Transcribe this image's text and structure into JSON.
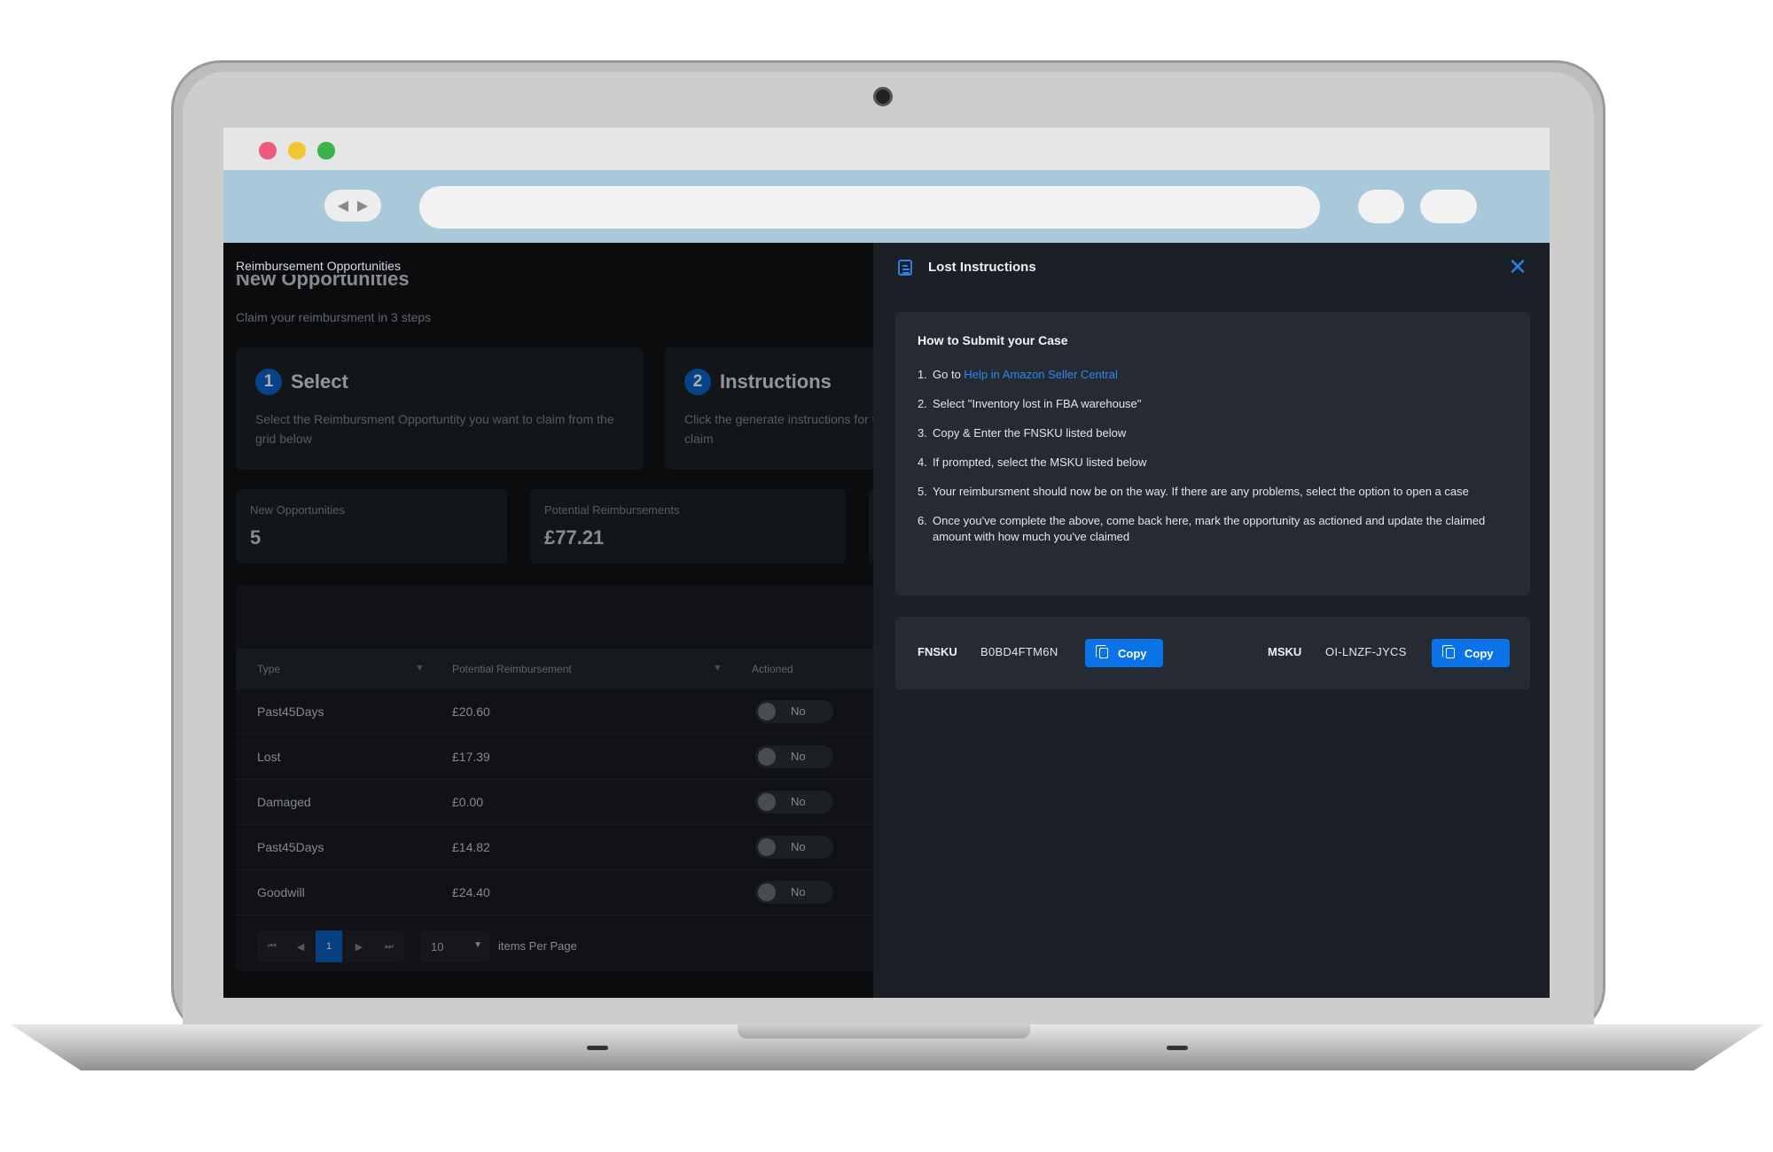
{
  "page": {
    "breadcrumb": "Reimbursement Opportunities",
    "title": "New Opportunities",
    "subtitle": "Claim your reimbursment in 3 steps"
  },
  "steps": [
    {
      "number": "1",
      "title": "Select",
      "description": "Select the Reimbursment Opportuntity you want to claim from the grid below"
    },
    {
      "number": "2",
      "title": "Instructions",
      "description": "Click the generate instructions for the opportunity you want to claim"
    }
  ],
  "kpis": [
    {
      "label": "New Opportunities",
      "value": "5"
    },
    {
      "label": "Potential Reimbursements",
      "value": "£77.21"
    }
  ],
  "grid": {
    "columns": [
      "Type",
      "Potential Reimbursement",
      "Actioned"
    ],
    "rows": [
      {
        "type": "Past45Days",
        "amount": "£20.60",
        "actioned": "No"
      },
      {
        "type": "Lost",
        "amount": "£17.39",
        "actioned": "No"
      },
      {
        "type": "Damaged",
        "amount": "£0.00",
        "actioned": "No"
      },
      {
        "type": "Past45Days",
        "amount": "£14.82",
        "actioned": "No"
      },
      {
        "type": "Goodwill",
        "amount": "£24.40",
        "actioned": "No"
      }
    ],
    "pager": {
      "current_page": "1",
      "per_page": "10",
      "per_page_label": "items Per Page"
    }
  },
  "drawer": {
    "title": "Lost Instructions",
    "how_title": "How to Submit your Case",
    "steps": [
      {
        "n": "1.",
        "prefix": "Go to ",
        "link": "Help in Amazon Seller Central"
      },
      {
        "n": "2.",
        "text": "Select \"Inventory lost in FBA warehouse\""
      },
      {
        "n": "3.",
        "text": "Copy & Enter the FNSKU listed below"
      },
      {
        "n": "4.",
        "text": "If prompted, select the MSKU listed below"
      },
      {
        "n": "5.",
        "text": "Your reimbursment should now be on the way. If there are any problems, select the option to open a case"
      },
      {
        "n": "6.",
        "text": "Once you've complete the above, come back here, mark the opportunity as actioned and update the claimed amount with how much you've claimed"
      }
    ],
    "fnsku_label": "FNSKU",
    "fnsku_value": "B0BD4FTM6N",
    "msku_label": "MSKU",
    "msku_value": "OI-LNZF-JYCS",
    "copy_label": "Copy"
  },
  "colors": {
    "accent": "#0b73e8",
    "link": "#2d86f0",
    "drawer_bg": "#1b1f26",
    "card_bg": "#262b33",
    "traffic_red": "#ee5a7c",
    "traffic_yellow": "#f4c532",
    "traffic_green": "#3cb34a"
  }
}
